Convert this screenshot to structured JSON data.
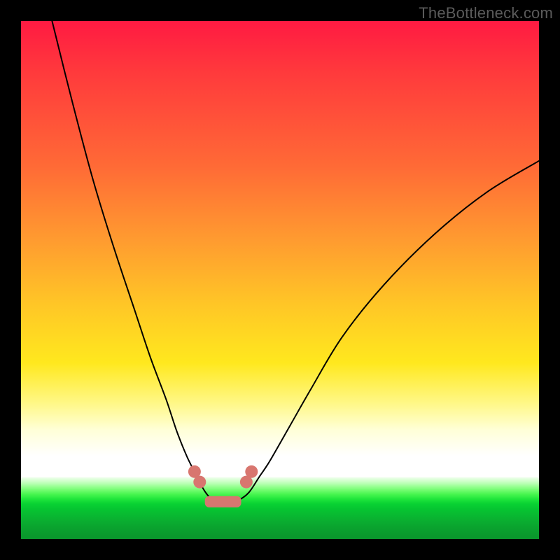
{
  "watermark": "TheBottleneck.com",
  "chart_data": {
    "type": "line",
    "title": "",
    "xlabel": "",
    "ylabel": "",
    "xlim": [
      0,
      100
    ],
    "ylim": [
      0,
      100
    ],
    "grid": false,
    "legend": false,
    "series": [
      {
        "name": "left-curve",
        "x": [
          6,
          10,
          14,
          18,
          22,
          25,
          28,
          30,
          32,
          34,
          35,
          36,
          37,
          38,
          40
        ],
        "y": [
          100,
          84,
          69,
          56,
          44,
          35,
          27,
          21,
          16,
          12,
          10,
          8.5,
          7.5,
          7,
          7
        ]
      },
      {
        "name": "right-curve",
        "x": [
          40,
          42,
          44,
          46,
          48,
          52,
          56,
          62,
          70,
          80,
          90,
          100
        ],
        "y": [
          7,
          7.5,
          9,
          12,
          15,
          22,
          29,
          39,
          49,
          59,
          67,
          73
        ]
      }
    ],
    "markers": {
      "color": "#d8766f",
      "points": [
        {
          "x": 33.5,
          "y": 13
        },
        {
          "x": 34.5,
          "y": 11
        },
        {
          "x": 43.5,
          "y": 11
        },
        {
          "x": 44.5,
          "y": 13
        }
      ],
      "bottom_band": {
        "x0": 35.5,
        "x1": 42.5,
        "y": 7.2
      }
    },
    "background_gradient": {
      "orientation": "vertical",
      "stops": [
        {
          "pos": 0.0,
          "color": "#ff1a42"
        },
        {
          "pos": 0.55,
          "color": "#ffc726"
        },
        {
          "pos": 0.84,
          "color": "#ffffff"
        },
        {
          "pos": 1.0,
          "color": "#0a952c"
        }
      ]
    }
  }
}
